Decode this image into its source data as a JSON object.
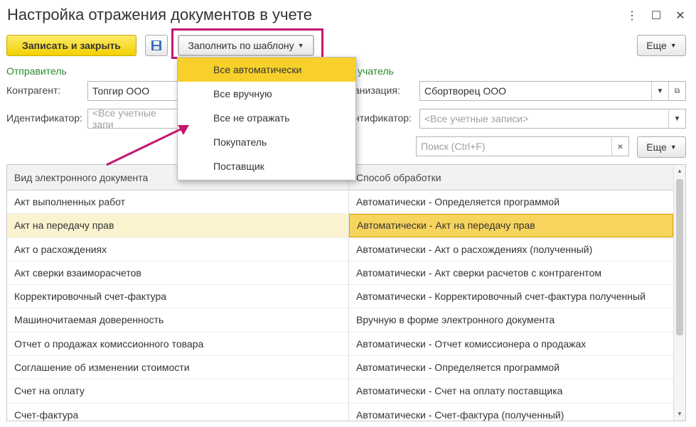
{
  "window": {
    "title": "Настройка отражения документов в учете",
    "menu_icon": "⋮",
    "maximize_icon": "☐",
    "close_icon": "✕"
  },
  "toolbar": {
    "save_close_label": "Записать и закрыть",
    "fill_template_label": "Заполнить по шаблону",
    "more_label": "Еще"
  },
  "sender": {
    "section_label": "Отправитель",
    "counterparty_label": "Контрагент:",
    "counterparty_value": "Топгир ООО",
    "identifier_label": "Идентификатор:",
    "identifier_placeholder": "<Все учетные запи"
  },
  "receiver": {
    "section_label": "учатель",
    "org_label": "анизация:",
    "org_value": "Сбортворец ООО",
    "identifier_label": "нтификатор:",
    "identifier_placeholder": "<Все учетные записи>"
  },
  "search": {
    "placeholder": "Поиск (Ctrl+F)",
    "clear_icon": "×",
    "more_label": "Еще"
  },
  "dropdown": {
    "items": [
      "Все автоматически",
      "Все вручную",
      "Все не отражать",
      "Покупатель",
      "Поставщик"
    ]
  },
  "table": {
    "headers": [
      "Вид электронного документа",
      "Способ обработки"
    ],
    "rows": [
      [
        "Акт выполненных работ",
        "Автоматически -  Определяется программой"
      ],
      [
        "Акт на передачу прав",
        "Автоматически -  Акт на передачу прав"
      ],
      [
        "Акт о расхождениях",
        "Автоматически -  Акт о расхождениях (полученный)"
      ],
      [
        "Акт сверки взаиморасчетов",
        "Автоматически -  Акт сверки расчетов с контрагентом"
      ],
      [
        "Корректировочный счет-фактура",
        "Автоматически -  Корректировочный счет-фактура полученный"
      ],
      [
        "Машиночитаемая доверенность",
        "Вручную в форме электронного документа"
      ],
      [
        "Отчет о продажах комиссионного товара",
        "Автоматически -  Отчет комиссионера о продажах"
      ],
      [
        "Соглашение об изменении стоимости",
        "Автоматически -  Определяется программой"
      ],
      [
        "Счет на оплату",
        "Автоматически -  Счет на оплату поставщика"
      ],
      [
        "Счет-фактура",
        "Автоматически -  Счет-фактура (полученный)"
      ]
    ]
  },
  "colors": {
    "primary_button": "#f4d000",
    "highlight": "#c4176c",
    "selected_row": "#f7d45e",
    "section_label": "#2a8a2a"
  }
}
